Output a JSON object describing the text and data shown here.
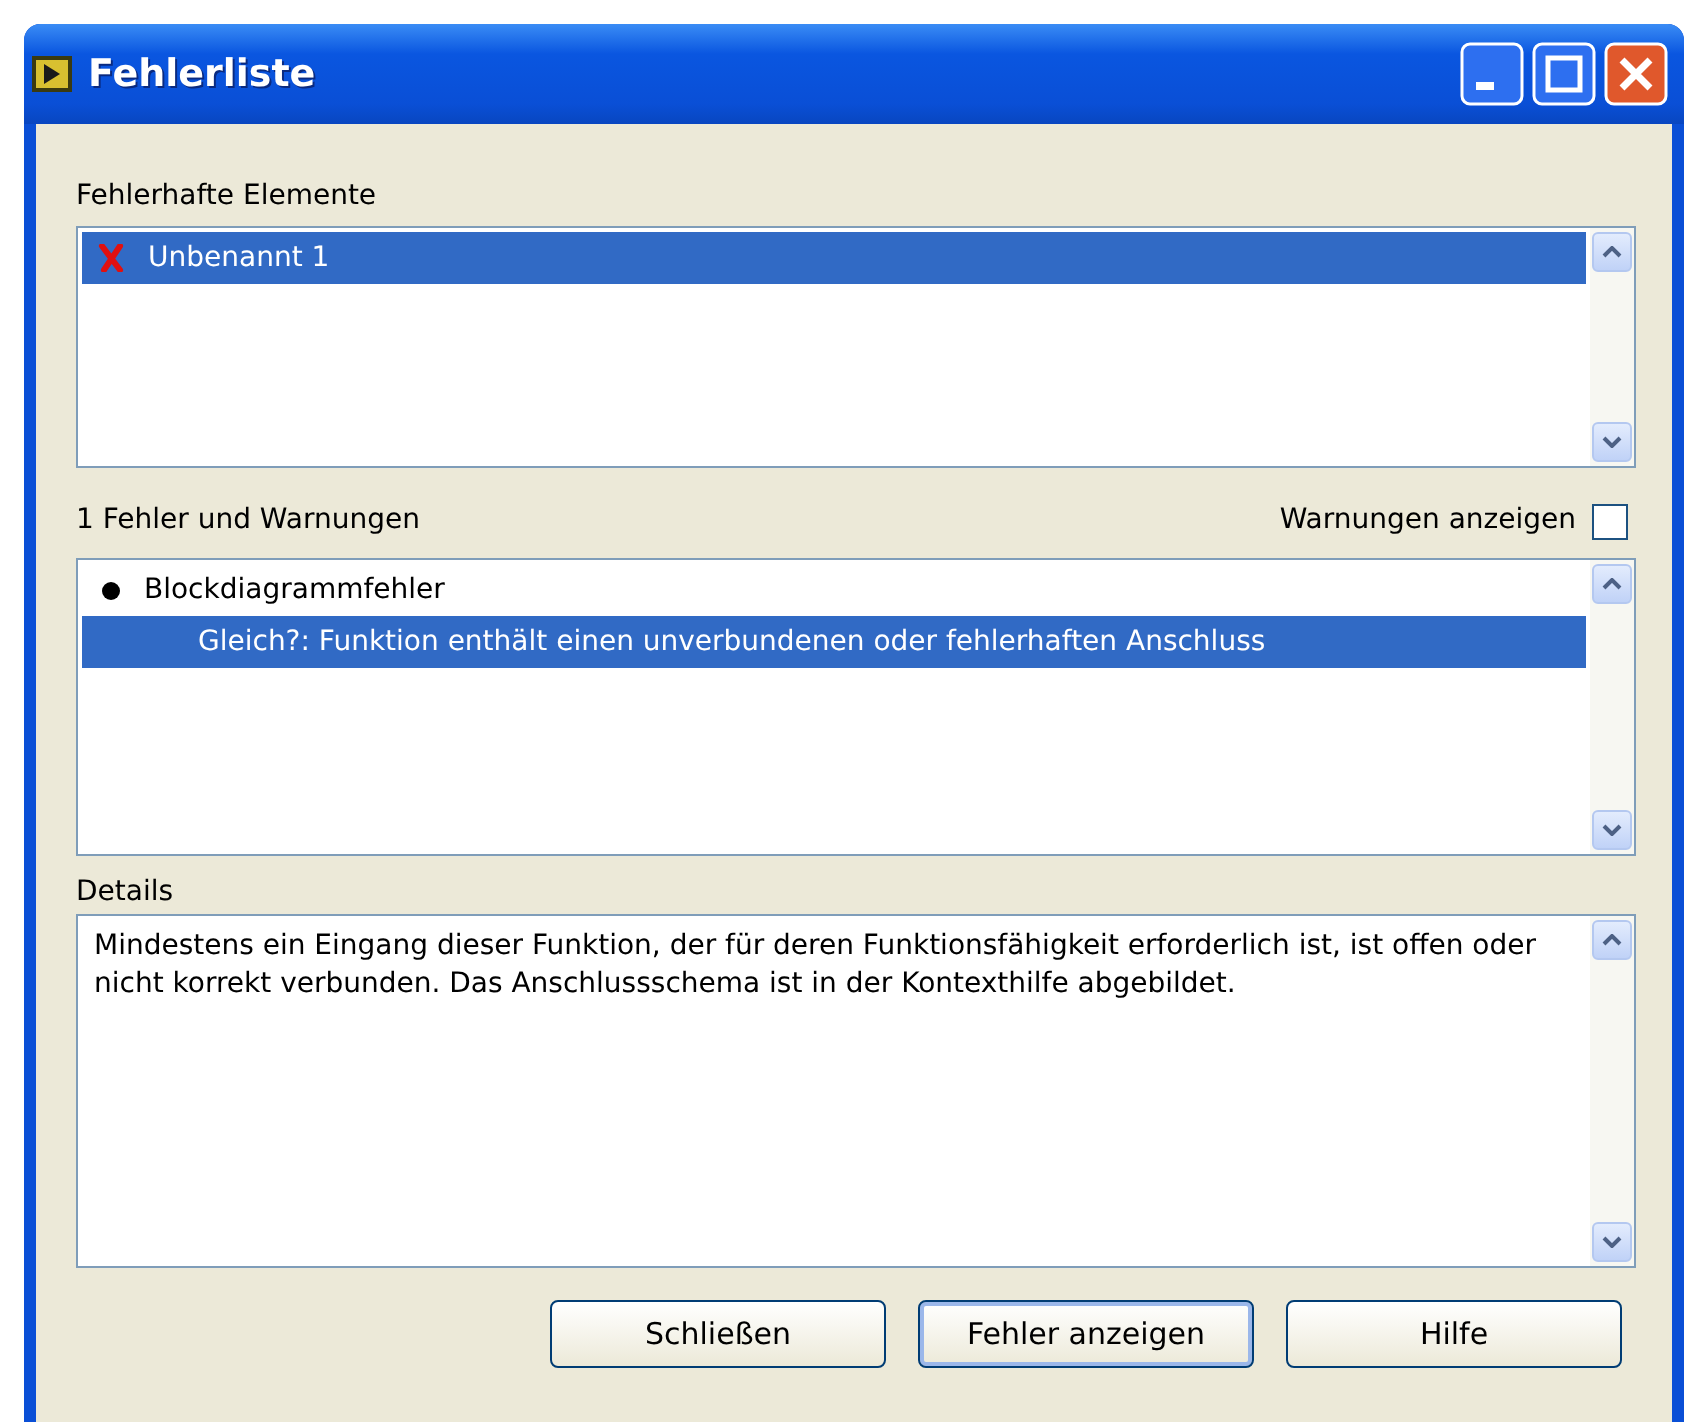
{
  "window": {
    "title": "Fehlerliste"
  },
  "elements": {
    "label": "Fehlerhafte Elemente",
    "items": [
      {
        "text": "Unbenannt 1",
        "selected": true
      }
    ]
  },
  "errors": {
    "count_label": "1 Fehler und Warnungen",
    "show_warnings": {
      "label": "Warnungen anzeigen",
      "checked": false
    },
    "items": [
      {
        "text": "Blockdiagrammfehler",
        "selected": false,
        "children": [
          {
            "text": "Gleich?: Funktion enthält einen unverbundenen oder fehlerhaften Anschluss",
            "selected": true
          }
        ]
      }
    ]
  },
  "details": {
    "label": "Details",
    "text": "Mindestens ein Eingang dieser Funktion, der für deren Funktionsfähigkeit erforderlich ist, ist offen oder nicht korrekt verbunden. Das Anschlussschema ist in der Kontexthilfe abgebildet."
  },
  "buttons": [
    "Schließen",
    "Fehler anzeigen",
    "Hilfe"
  ]
}
